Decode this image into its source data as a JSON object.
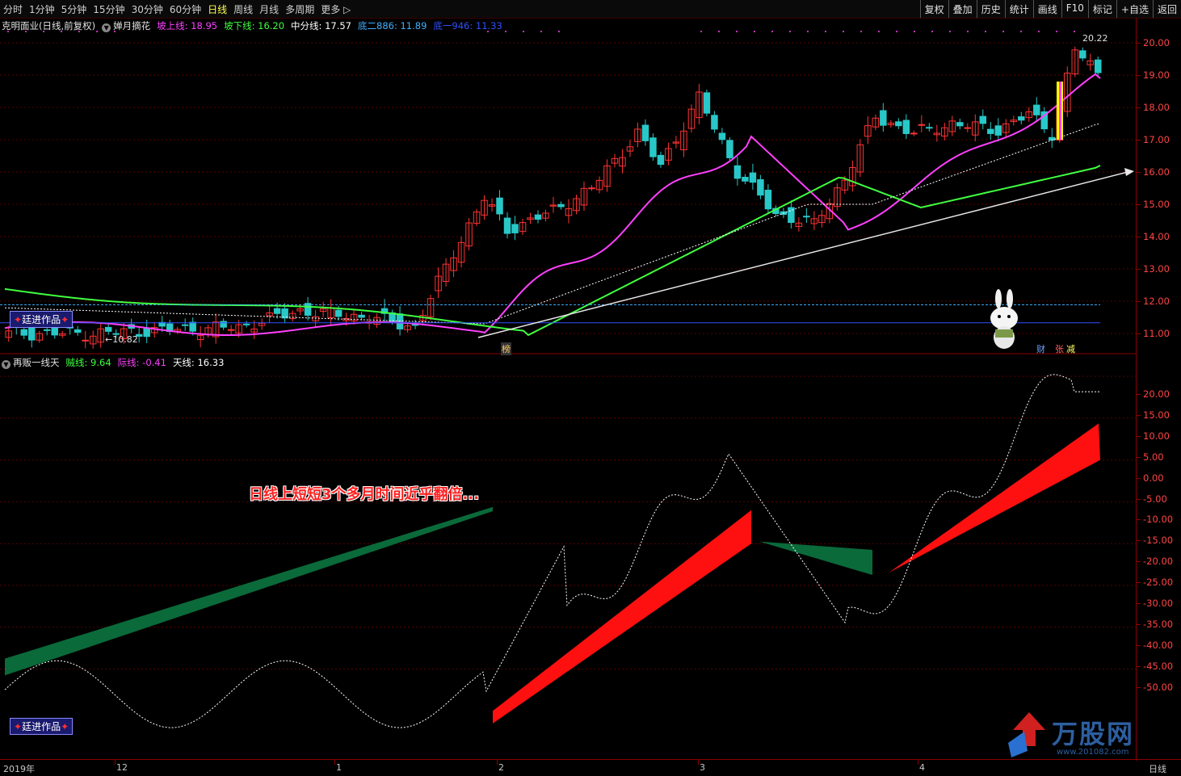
{
  "toolbar": {
    "periods": [
      "分时",
      "1分钟",
      "5分钟",
      "15分钟",
      "30分钟",
      "60分钟",
      "日线",
      "周线",
      "月线",
      "多周期",
      "更多"
    ],
    "active": "日线",
    "buttons": [
      "复权",
      "叠加",
      "历史",
      "统计",
      "画线",
      "F10",
      "标记",
      "+自选",
      "返回"
    ]
  },
  "top_panel": {
    "stock": "克明面业(日线,前复权)",
    "indicator": "婵月摘花",
    "values": [
      {
        "label": "坡上线: 18.95",
        "color": "#ff40ff"
      },
      {
        "label": "坡下线: 16.20",
        "color": "#40ff40"
      },
      {
        "label": "中分线: 17.57",
        "color": "#ffffff"
      },
      {
        "label": "底二886: 11.89",
        "color": "#40b0ff"
      },
      {
        "label": "底一946: 11.33",
        "color": "#3050ff"
      }
    ],
    "high_label": "20.22",
    "low_label": "10.82",
    "badge": "廷进作品",
    "tags": {
      "bang": "榜",
      "cai": "财",
      "zhang": "张",
      "jian": "减"
    }
  },
  "bottom_panel": {
    "indicator": "再贩一线天",
    "values": [
      {
        "label": "贼线: 9.64",
        "color": "#40ff40"
      },
      {
        "label": "际线: -0.41",
        "color": "#ff40ff"
      },
      {
        "label": "天线: 16.33",
        "color": "#ffffff"
      }
    ],
    "badge": "廷进作品",
    "annotation": "日线上短短3个多月时间近乎翻倍..."
  },
  "y_axis_top": [
    "20.00",
    "19.00",
    "18.00",
    "17.00",
    "16.00",
    "15.00",
    "14.00",
    "13.00",
    "12.00",
    "11.00"
  ],
  "y_axis_bottom": [
    "20.00",
    "15.00",
    "10.00",
    "5.00",
    "0.00",
    "-5.00",
    "-10.00",
    "-15.00",
    "-20.00",
    "-25.00",
    "-30.00",
    "-35.00",
    "-40.00",
    "-45.00",
    "-50.00"
  ],
  "x_axis": [
    "2019年",
    "12",
    "1",
    "2",
    "3",
    "4",
    "日线"
  ],
  "watermark": {
    "brand": "万股网",
    "url": "www.201082.com"
  },
  "colors": {
    "up": "#ff3333",
    "down": "#28c8c8",
    "grid": "#8b0000"
  }
}
